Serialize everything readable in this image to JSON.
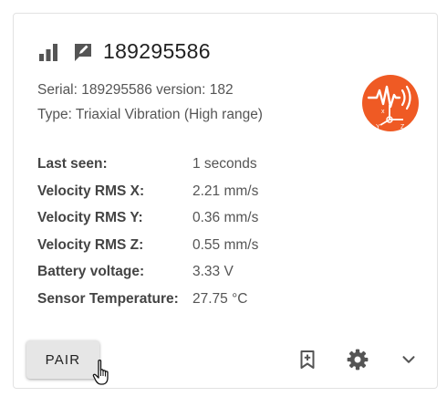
{
  "sensor": {
    "title": "189295586",
    "serial_line": "Serial: 189295586 version: 182",
    "type_line": "Type: Triaxial Vibration (High range)"
  },
  "details": [
    {
      "label": "Last seen:",
      "value": "1 seconds"
    },
    {
      "label": "Velocity RMS X:",
      "value": "2.21 mm/s"
    },
    {
      "label": "Velocity RMS Y:",
      "value": "0.36 mm/s"
    },
    {
      "label": "Velocity RMS Z:",
      "value": "0.55 mm/s"
    },
    {
      "label": "Battery voltage:",
      "value": "3.33 V"
    },
    {
      "label": "Sensor Temperature:",
      "value": "27.75 °C"
    }
  ],
  "actions": {
    "pair_label": "PAIR"
  },
  "icons": {
    "signal": "signal-bars-icon",
    "edit": "edit-note-icon",
    "logo": "triaxial-vibration-logo",
    "bookmark": "bookmark-add-icon",
    "settings": "gear-icon",
    "expand": "chevron-down-icon"
  },
  "colors": {
    "logo_orange": "#ef5a24",
    "icon_gray": "#555555",
    "button_bg": "#e6e6e6"
  }
}
